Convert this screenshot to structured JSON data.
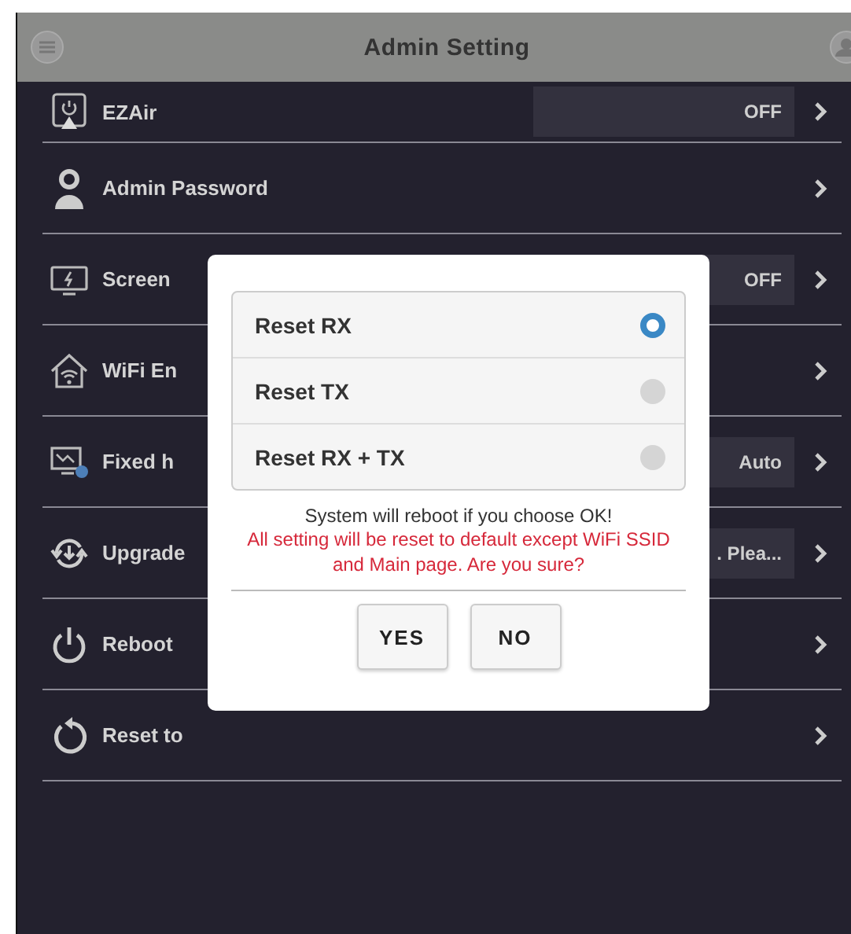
{
  "header": {
    "title": "Admin Setting"
  },
  "settings": [
    {
      "label": "EZAir",
      "value": "OFF"
    },
    {
      "label": "Admin Password"
    },
    {
      "label": "Screen",
      "value": "OFF"
    },
    {
      "label": "WiFi En"
    },
    {
      "label": "Fixed h",
      "value": "Auto"
    },
    {
      "label": "Upgrade",
      "value": ". Plea..."
    },
    {
      "label": "Reboot"
    },
    {
      "label": "Reset to"
    }
  ],
  "dialog": {
    "options": [
      {
        "label": "Reset RX",
        "selected": true
      },
      {
        "label": "Reset TX",
        "selected": false
      },
      {
        "label": "Reset RX + TX",
        "selected": false
      }
    ],
    "message": "System will reboot if you choose OK!",
    "warning": "All setting will be reset to default except WiFi SSID and Main page. Are you sure?",
    "buttons": [
      "YES",
      "NO"
    ]
  }
}
